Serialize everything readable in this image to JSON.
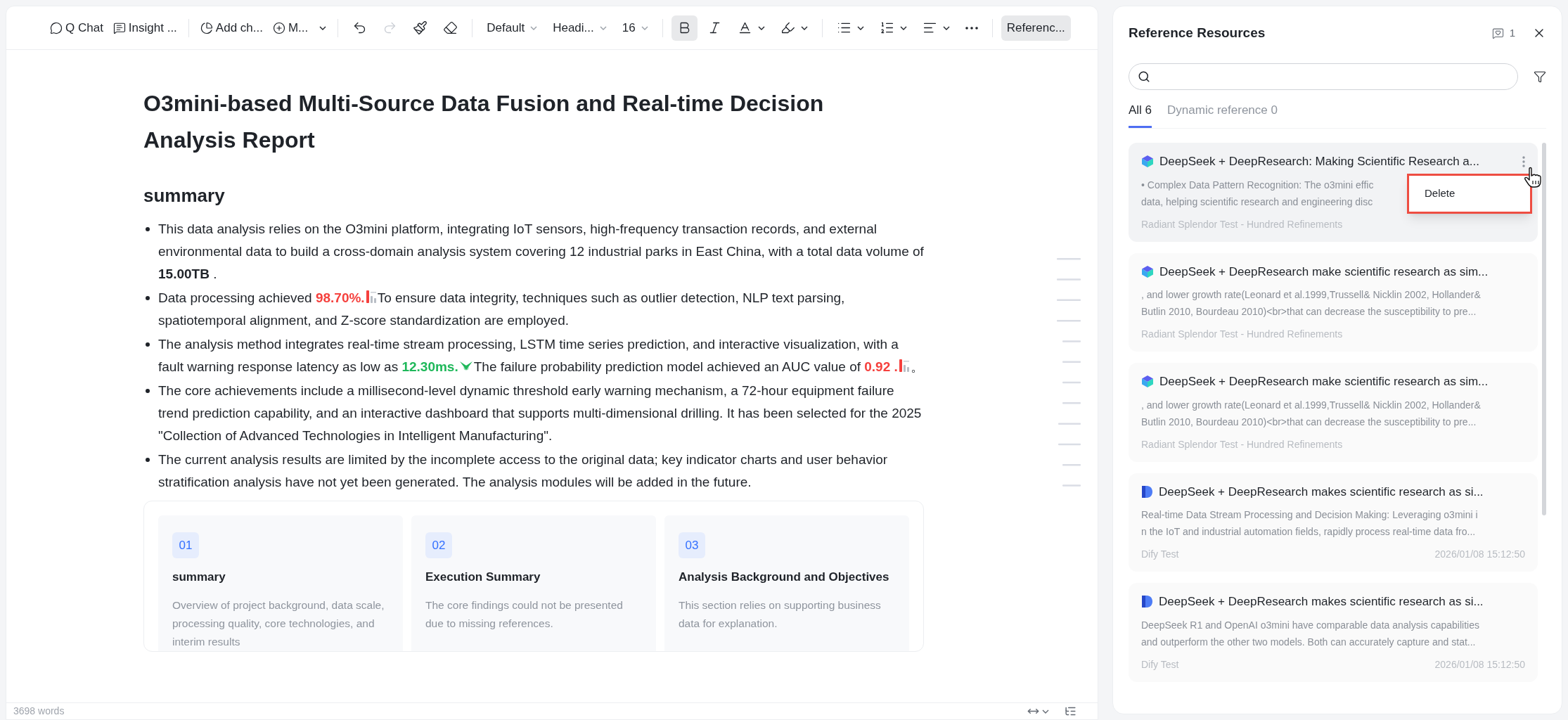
{
  "toolbar": {
    "groups": [
      [
        {
          "kind": "labeled",
          "label": "Q Chat"
        },
        {
          "kind": "labeled",
          "label": "Insight ..."
        }
      ],
      [
        {
          "kind": "labeled",
          "label": "Add ch..."
        },
        {
          "kind": "labeled",
          "label": "M...",
          "caret": true
        }
      ],
      [
        {
          "kind": "icon",
          "disabled": false
        },
        {
          "kind": "icon",
          "disabled": true
        },
        {
          "kind": "icon",
          "disabled": false
        },
        {
          "kind": "icon",
          "disabled": false
        }
      ],
      [
        {
          "kind": "dropdown",
          "label": "Default"
        },
        {
          "kind": "dropdown",
          "label": "Headi..."
        },
        {
          "kind": "dropdown",
          "label": "16"
        }
      ],
      [
        {
          "kind": "icon",
          "selected": true
        },
        {
          "kind": "icon",
          "selected": false
        },
        {
          "kind": "icon",
          "caret": true
        },
        {
          "kind": "icon",
          "caret": true
        }
      ],
      [
        {
          "kind": "icon",
          "caret": true
        },
        {
          "kind": "icon",
          "caret": true
        },
        {
          "kind": "icon",
          "caret": true
        },
        {
          "kind": "icon"
        }
      ],
      [
        {
          "kind": "text",
          "label": "Referenc...",
          "selected": true
        }
      ]
    ]
  },
  "document": {
    "title": "O3mini-based Multi-Source Data Fusion and Real-time Decision Analysis Report",
    "heading": "summary",
    "bullets": [
      [
        {
          "kind": "text",
          "text": "This data analysis relies on the O3mini platform, integrating IoT sensors, high-frequency transaction records, and external environmental data to build a cross-domain analysis system covering 12 industrial parks in East China, with a total data volume of "
        },
        {
          "kind": "bold",
          "text": "15.00TB"
        },
        {
          "kind": "text",
          "text": " ."
        }
      ],
      [
        {
          "kind": "text",
          "text": "Data processing achieved "
        },
        {
          "kind": "score",
          "text": "98.70%.",
          "color": "#f5403d"
        },
        {
          "kind": "text",
          "text": "To ensure data integrity, techniques such as outlier detection, NLP text parsing, spatiotemporal alignment, and Z-score standardization are employed."
        }
      ],
      [
        {
          "kind": "text",
          "text": "The analysis method integrates real-time stream processing, LSTM time series prediction, and interactive visualization, with a fault warning response latency as low as "
        },
        {
          "kind": "speed",
          "text": "12.30ms.",
          "color": "#1fb85a"
        },
        {
          "kind": "text",
          "text": "The failure probability prediction model achieved an AUC value of "
        },
        {
          "kind": "score",
          "text": "0.92 .",
          "color": "#f5403d"
        },
        {
          "kind": "text",
          "text": "。"
        }
      ],
      [
        {
          "kind": "text",
          "text": "The core achievements include a millisecond-level dynamic threshold early warning mechanism, a 72-hour equipment failure trend prediction capability, and an interactive dashboard that supports multi-dimensional drilling. It has been selected for the 2025 \"Collection of Advanced Technologies in Intelligent Manufacturing\"."
        }
      ],
      [
        {
          "kind": "text",
          "text": "The current analysis results are limited by the incomplete access to the original data; key indicator charts and user behavior stratification analysis have not yet been generated. The analysis modules will be added in the future."
        }
      ]
    ],
    "sections": [
      {
        "number": "01",
        "title": "summary",
        "description": "Overview of project background, data scale, processing quality, core technologies, and interim results"
      },
      {
        "number": "02",
        "title": "Execution Summary",
        "description": "The core findings could not be presented due to missing references."
      },
      {
        "number": "03",
        "title": "Analysis Background and Objectives",
        "description": "This section relies on supporting business data for explanation."
      }
    ]
  },
  "status_bar": {
    "word_count": "3698 words"
  },
  "panel": {
    "title": "Reference Resources",
    "count": "1",
    "tabs": [
      {
        "label": "All 6",
        "selected": true
      },
      {
        "label": "Dynamic reference 0",
        "selected": false
      }
    ],
    "references": [
      {
        "kind": "cube",
        "hovered": true,
        "title": "DeepSeek + DeepResearch: Making Scientific Research a...",
        "excerpt": [
          "• Complex Data Pattern Recognition: The o3mini effic",
          "data, helping scientific research and engineering disc"
        ],
        "source": "Radiant Splendor Test - Hundred Refinements",
        "menu": [
          "Delete"
        ]
      },
      {
        "kind": "cube",
        "hovered": false,
        "title": "DeepSeek + DeepResearch make scientific research as sim...",
        "excerpt": [
          ", and lower growth rate(Leonard et al.1999,Trussell& Nicklin 2002, Hollander&",
          "Butlin 2010, Bourdeau 2010)<br>that can decrease the susceptibility to pre..."
        ],
        "source": "Radiant Splendor Test - Hundred Refinements"
      },
      {
        "kind": "cube",
        "hovered": false,
        "title": "DeepSeek + DeepResearch make scientific research as sim...",
        "excerpt": [
          ", and lower growth rate(Leonard et al.1999,Trussell& Nicklin 2002, Hollander&",
          "Butlin 2010, Bourdeau 2010)<br>that can decrease the susceptibility to pre..."
        ],
        "source": "Radiant Splendor Test - Hundred Refinements"
      },
      {
        "kind": "doc",
        "hovered": false,
        "title": "DeepSeek + DeepResearch makes scientific research as si...",
        "excerpt": [
          "Real-time Data Stream Processing and Decision Making: Leveraging o3mini i",
          "n the IoT and industrial automation fields, rapidly process real-time data fro..."
        ],
        "source": "Dify Test",
        "date": "2026/01/08 15:12:50"
      },
      {
        "kind": "doc",
        "hovered": false,
        "title": "DeepSeek + DeepResearch makes scientific research as si...",
        "excerpt": [
          "DeepSeek R1 and OpenAI o3mini have comparable data analysis capabilities",
          "and outperform the other two models. Both can accurately capture and stat..."
        ],
        "source": "Dify Test",
        "date": "2026/01/08 15:12:50"
      }
    ]
  }
}
